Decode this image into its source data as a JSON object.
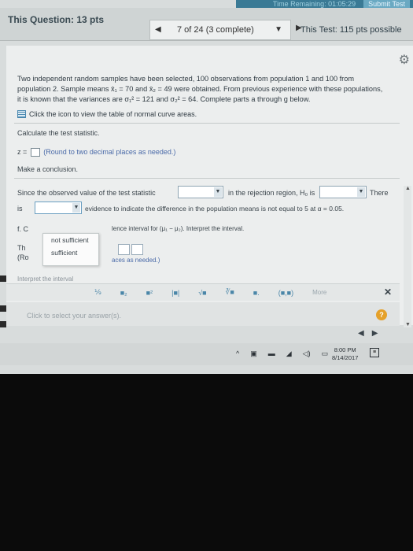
{
  "timer": {
    "label": "Time Remaining: 01:05:29",
    "submit": "Submit Test"
  },
  "header": {
    "points": "This Question: 13 pts",
    "position": "7 of 24 (3 complete)",
    "test_points": "This Test: 115 pts possible"
  },
  "problem": {
    "text": "Two independent random samples have been selected, 100 observations from population 1 and 100 from population 2. Sample means x̄₁ = 70 and x̄₂ = 49 were obtained. From previous experience with these populations, it is known that the variances are σ₁² = 121 and σ₂² = 64. Complete parts a through g below.",
    "table_link": "Click the icon to view the table of normal curve areas."
  },
  "part": {
    "calc_label": "Calculate the test statistic.",
    "z_prefix": "z =",
    "z_hint": "(Round to two decimal places as needed.)",
    "conclusion_label": "Make a conclusion.",
    "since_text": "Since the observed value of the test statistic",
    "rejection_text": "in the rejection region, H₀ is",
    "there_text": "There",
    "is_text": "is",
    "evidence_text": "evidence to indicate the difference in the population means is not equal to 5 at α = 0.05.",
    "ci_prefix": "f. C",
    "ci_text": "lence interval for (μ₁ − μ₂). Interpret the interval.",
    "th_text": "Th",
    "ro_text": "(Ro",
    "ci_hint": "aces as needed.)",
    "interpret_text": "Interpret the interval"
  },
  "dropdown_menu": {
    "options": [
      "not sufficient",
      "sufficient"
    ]
  },
  "toolbar": {
    "buttons": [
      "⅑",
      "■₂",
      "■²",
      "|■|",
      "√■",
      "∛■",
      "■.",
      "(■,■)"
    ],
    "more": "More",
    "close": "✕"
  },
  "answer": {
    "hint": "Click to select your answer(s).",
    "help": "?"
  },
  "taskbar": {
    "time": "8:00 PM",
    "date": "8/14/2017"
  }
}
